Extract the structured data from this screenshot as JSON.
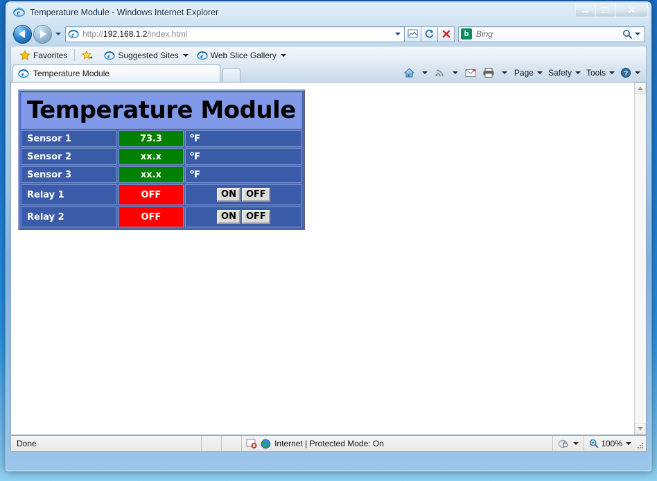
{
  "window": {
    "title": "Temperature Module - Windows Internet Explorer",
    "minimize_label": "Minimize",
    "maximize_label": "Maximize",
    "close_label": "Close"
  },
  "navbar": {
    "back_label": "Back",
    "forward_label": "Forward",
    "recent_pages_label": "Recent Pages",
    "url_scheme": "http://",
    "url_host": "192.168.1.2",
    "url_path": "/index.html",
    "compat_view_label": "Compatibility View",
    "refresh_label": "Refresh",
    "stop_label": "Stop",
    "search_placeholder": "Bing",
    "search_value": "",
    "search_provider": "Bing",
    "search_go_label": "Search"
  },
  "favorites_bar": {
    "favorites_label": "Favorites",
    "items": [
      {
        "label": "Suggested Sites",
        "has_caret": true
      },
      {
        "label": "Web Slice Gallery",
        "has_caret": true
      }
    ]
  },
  "tabs": {
    "active": {
      "label": "Temperature Module"
    },
    "new_tab_label": "New Tab"
  },
  "command_bar": {
    "home_label": "Home",
    "feeds_label": "Feeds",
    "mail_label": "Read Mail",
    "print_label": "Print",
    "items": [
      {
        "label": "Page"
      },
      {
        "label": "Safety"
      },
      {
        "label": "Tools"
      }
    ],
    "help_label": "Help"
  },
  "page": {
    "heading": "Temperature Module",
    "rows": [
      {
        "label": "Sensor 1",
        "value": "73.3",
        "value_state": "green",
        "unit_sup": "o",
        "unit": "F",
        "kind": "sensor"
      },
      {
        "label": "Sensor 2",
        "value": "xx.x",
        "value_state": "green",
        "unit_sup": "o",
        "unit": "F",
        "kind": "sensor"
      },
      {
        "label": "Sensor 3",
        "value": "xx.x",
        "value_state": "green",
        "unit_sup": "o",
        "unit": "F",
        "kind": "sensor"
      },
      {
        "label": "Relay 1",
        "value": "OFF",
        "value_state": "red",
        "kind": "relay",
        "on_label": "ON",
        "off_label": "OFF"
      },
      {
        "label": "Relay 2",
        "value": "OFF",
        "value_state": "red",
        "kind": "relay",
        "on_label": "ON",
        "off_label": "OFF"
      }
    ],
    "colors": {
      "heading_bg": "#8099e8",
      "row_bg": "#3a5ca8",
      "table_bg": "#4a68b4",
      "value_green": "#008000",
      "value_red": "#ff0000",
      "text": "#ffffff",
      "heading_text": "#000000"
    }
  },
  "statusbar": {
    "status": "Done",
    "zone": "Internet | Protected Mode: On",
    "zoom": "100%",
    "privacy_label": "Privacy Report",
    "zoom_label": "Change Zoom Level"
  }
}
